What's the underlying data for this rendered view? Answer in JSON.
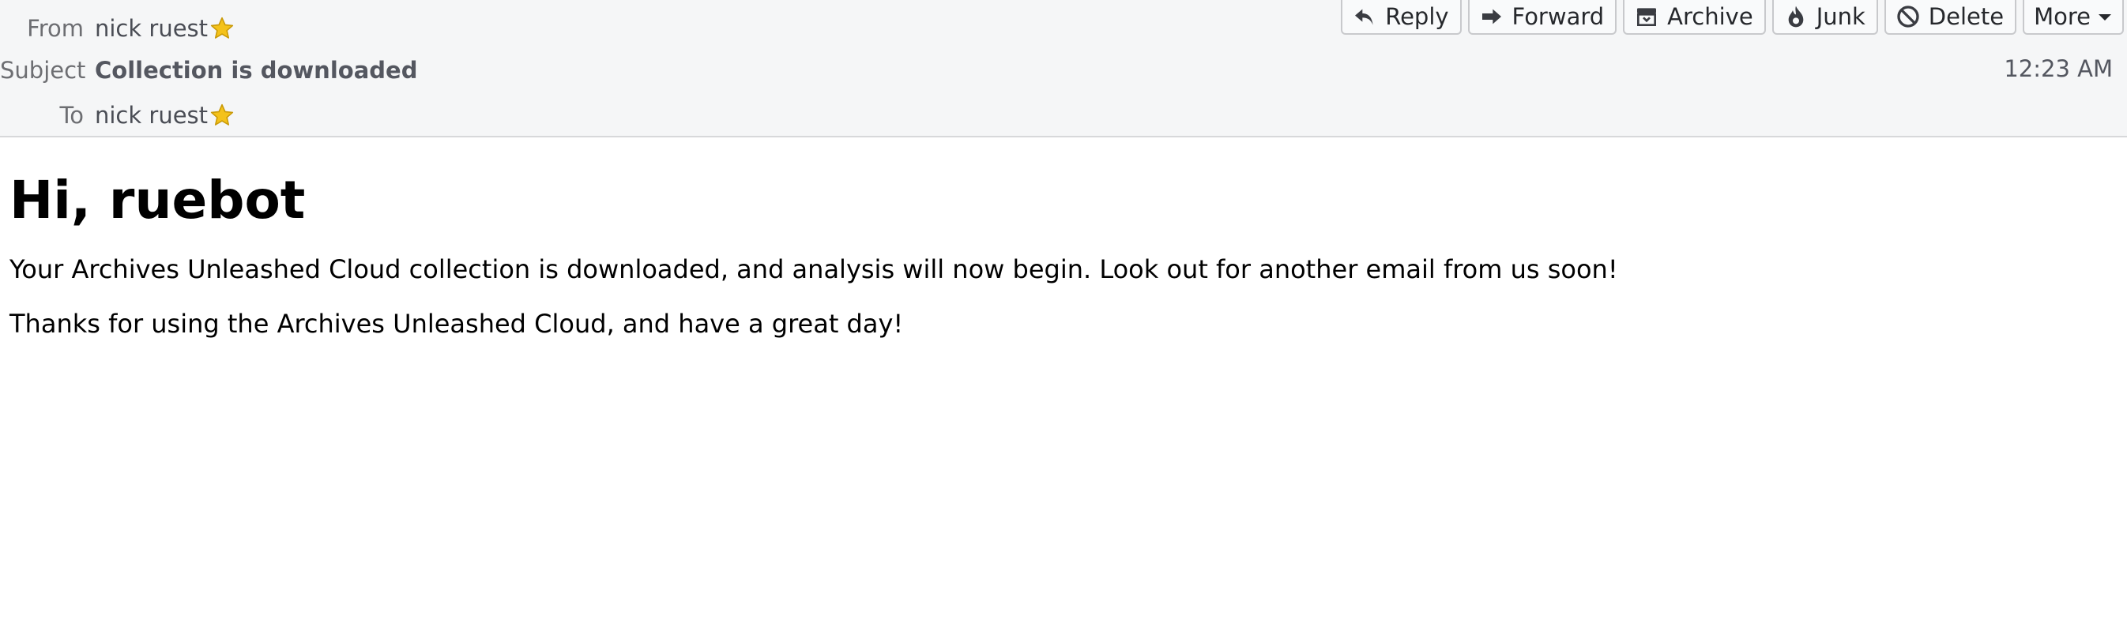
{
  "header": {
    "from_label": "From",
    "from_value": "nick ruest",
    "subject_label": "Subject",
    "subject_value": "Collection is downloaded",
    "to_label": "To",
    "to_value": "nick ruest",
    "time": "12:23 AM"
  },
  "toolbar": {
    "reply": "Reply",
    "forward": "Forward",
    "archive": "Archive",
    "junk": "Junk",
    "delete": "Delete",
    "more": "More"
  },
  "message": {
    "greeting": "Hi, ruebot",
    "paragraph1": "Your Archives Unleashed Cloud collection is downloaded, and analysis will now begin. Look out for another email from us soon!",
    "paragraph2": "Thanks for using the Archives Unleashed Cloud, and have a great day!"
  },
  "icons": {
    "star": "star-icon",
    "reply": "reply-icon",
    "forward": "forward-icon",
    "archive": "archive-icon",
    "junk": "junk-icon",
    "delete": "delete-icon",
    "more": "chevron-down-icon"
  },
  "colors": {
    "header_bg": "#f5f6f7",
    "star": "#f4c21a"
  }
}
